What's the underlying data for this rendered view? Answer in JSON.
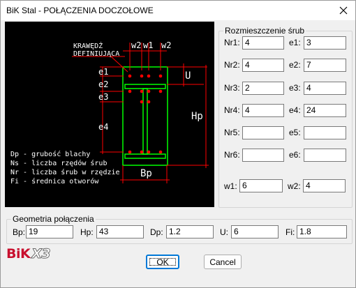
{
  "window": {
    "title": "BiK Stal - POŁĄCZENIA DOCZOŁOWE"
  },
  "diagram": {
    "label_krawedz": "KRAWĘDŹ",
    "label_definiujaca": "DEFINIUJĄCA",
    "label_w2_left": "w2",
    "label_w1": "w1",
    "label_w2_right": "w2",
    "label_e1": "e1",
    "label_e2": "e2",
    "label_e3": "e3",
    "label_e4": "e4",
    "label_U": "U",
    "label_Hp": "Hp",
    "label_Bp": "Bp",
    "legend": [
      "Dp - grubość blachy",
      "Ns - liczba rzędów śrub",
      "Nr - liczba śrub w rzędzie",
      "Fi - średnica otworów"
    ],
    "colors": {
      "background": "#000000",
      "plate": "#00ff00",
      "bolts": "#ff0000",
      "dimensions": "#ff0000",
      "text": "#ffffff"
    }
  },
  "bolts": {
    "legend": "Rozmieszczenie śrub",
    "fields": {
      "nr1": {
        "label": "Nr1:",
        "value": "4"
      },
      "e1": {
        "label": "e1:",
        "value": "3"
      },
      "nr2": {
        "label": "Nr2:",
        "value": "4"
      },
      "e2": {
        "label": "e2:",
        "value": "7"
      },
      "nr3": {
        "label": "Nr3:",
        "value": "2"
      },
      "e3": {
        "label": "e3:",
        "value": "4"
      },
      "nr4": {
        "label": "Nr4:",
        "value": "4"
      },
      "e4": {
        "label": "e4:",
        "value": "24"
      },
      "nr5": {
        "label": "Nr5:",
        "value": ""
      },
      "e5": {
        "label": "e5:",
        "value": ""
      },
      "nr6": {
        "label": "Nr6:",
        "value": ""
      },
      "e6": {
        "label": "e6:",
        "value": ""
      },
      "w1": {
        "label": "w1:",
        "value": "6"
      },
      "w2": {
        "label": "w2:",
        "value": "4"
      }
    }
  },
  "geometry": {
    "legend": "Geometria połączenia",
    "fields": {
      "bp": {
        "label": "Bp:",
        "value": "19"
      },
      "hp": {
        "label": "Hp:",
        "value": "43"
      },
      "dp": {
        "label": "Dp:",
        "value": "1.2"
      },
      "u": {
        "label": "U:",
        "value": "6"
      },
      "fi": {
        "label": "Fi:",
        "value": "1.8"
      }
    }
  },
  "logo": {
    "brand": "BiK",
    "version": "X3",
    "colors": {
      "brand": "#c8102e"
    }
  },
  "buttons": {
    "ok": "OK",
    "cancel": "Cancel"
  }
}
